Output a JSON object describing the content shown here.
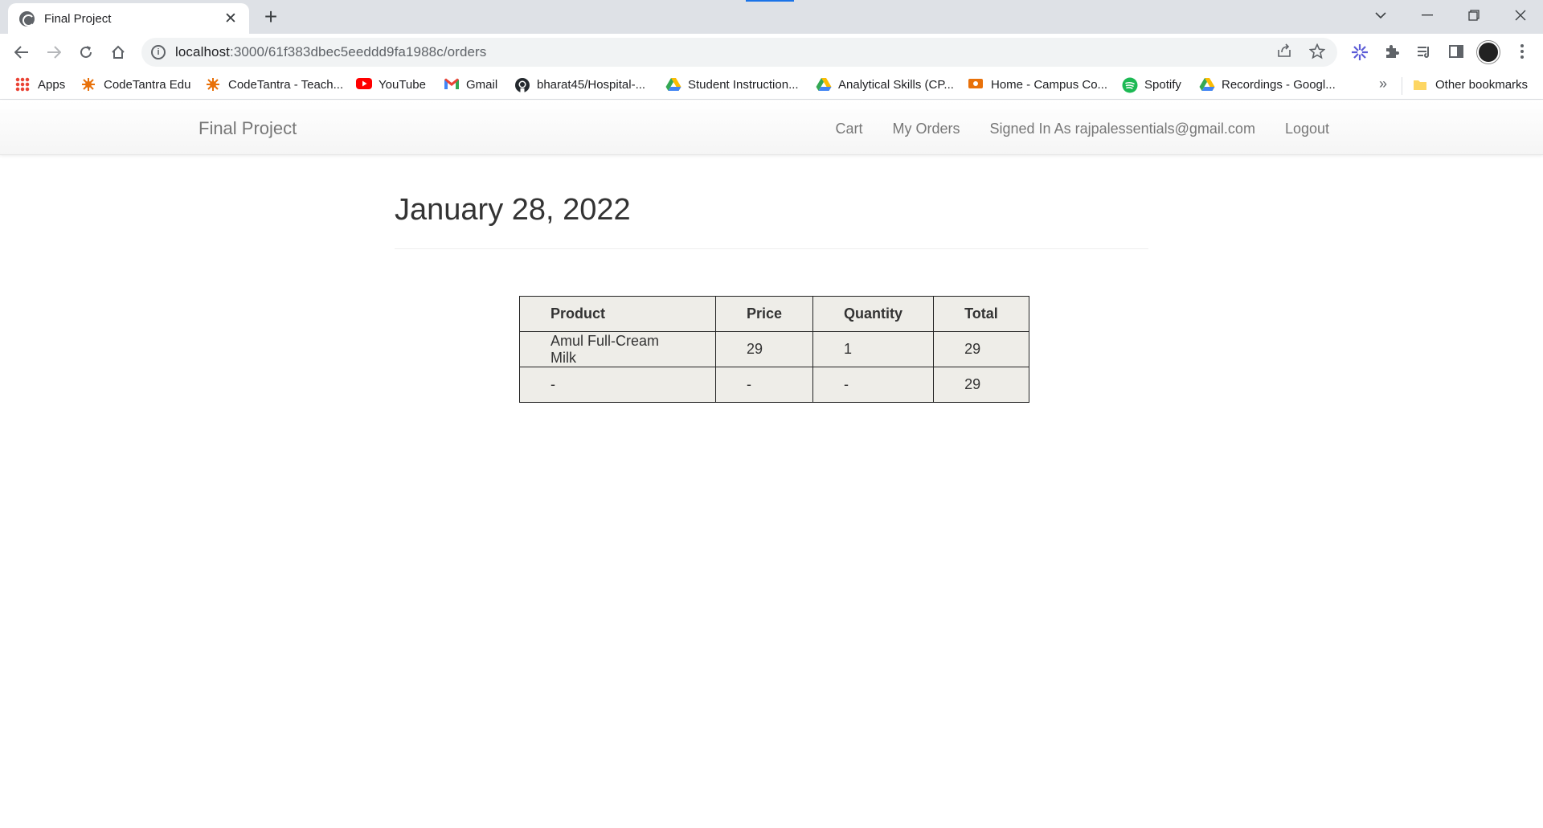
{
  "browser": {
    "tab_title": "Final Project",
    "tab_close": "✕",
    "new_tab": "+",
    "url_host": "localhost",
    "url_path": ":3000/61f383dbec5eeddd9fa1988c/orders",
    "bookmarks": [
      {
        "label": "Apps",
        "icon": "apps-grid-icon",
        "color": "#ea4335"
      },
      {
        "label": "CodeTantra Edu",
        "icon": "codetantra-icon",
        "color": "#e8710a"
      },
      {
        "label": "CodeTantra - Teach...",
        "icon": "codetantra-icon",
        "color": "#e8710a"
      },
      {
        "label": "YouTube",
        "icon": "youtube-icon",
        "color": "#ff0000"
      },
      {
        "label": "Gmail",
        "icon": "gmail-icon",
        "color": "#ea4335"
      },
      {
        "label": "bharat45/Hospital-...",
        "icon": "github-icon",
        "color": "#24292e"
      },
      {
        "label": "Student Instruction...",
        "icon": "drive-icon",
        "color": "#34a853"
      },
      {
        "label": "Analytical Skills (CP...",
        "icon": "drive-icon",
        "color": "#34a853"
      },
      {
        "label": "Home - Campus Co...",
        "icon": "campus-icon",
        "color": "#e8710a"
      },
      {
        "label": "Spotify",
        "icon": "spotify-icon",
        "color": "#1db954"
      },
      {
        "label": "Recordings - Googl...",
        "icon": "drive-icon",
        "color": "#34a853"
      }
    ],
    "more_bookmarks": "»",
    "other_bookmarks": "Other bookmarks"
  },
  "navbar": {
    "brand": "Final Project",
    "links": {
      "cart": "Cart",
      "my_orders": "My Orders",
      "signed_in": "Signed In As rajpalessentials@gmail.com",
      "logout": "Logout"
    }
  },
  "order": {
    "date": "January 28, 2022",
    "headers": [
      "Product",
      "Price",
      "Quantity",
      "Total"
    ],
    "rows": [
      [
        "Amul Full-Cream Milk",
        "29",
        "1",
        "29"
      ],
      [
        "-",
        "-",
        "-",
        "29"
      ]
    ]
  }
}
